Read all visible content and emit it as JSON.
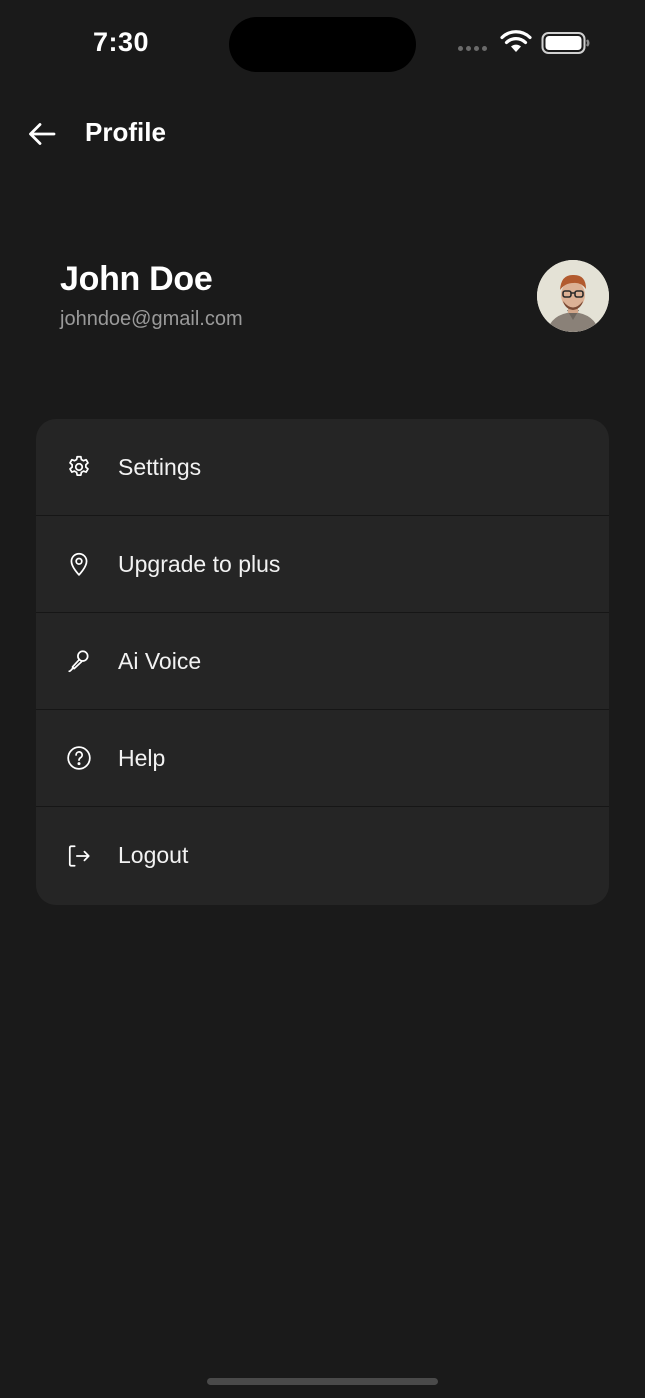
{
  "status_bar": {
    "time": "7:30"
  },
  "header": {
    "title": "Profile",
    "back_icon": "arrow-left-icon"
  },
  "profile": {
    "name": "John Doe",
    "email": "johndoe@gmail.com"
  },
  "menu": {
    "items": [
      {
        "label": "Settings",
        "icon": "gear-icon"
      },
      {
        "label": "Upgrade to plus",
        "icon": "location-pin-icon"
      },
      {
        "label": "Ai Voice",
        "icon": "microphone-icon"
      },
      {
        "label": "Help",
        "icon": "question-circle-icon"
      },
      {
        "label": "Logout",
        "icon": "logout-icon"
      }
    ]
  },
  "colors": {
    "background": "#1a1a1a",
    "card": "#252525",
    "text_primary": "#ffffff",
    "text_secondary": "#9a9a9a"
  }
}
